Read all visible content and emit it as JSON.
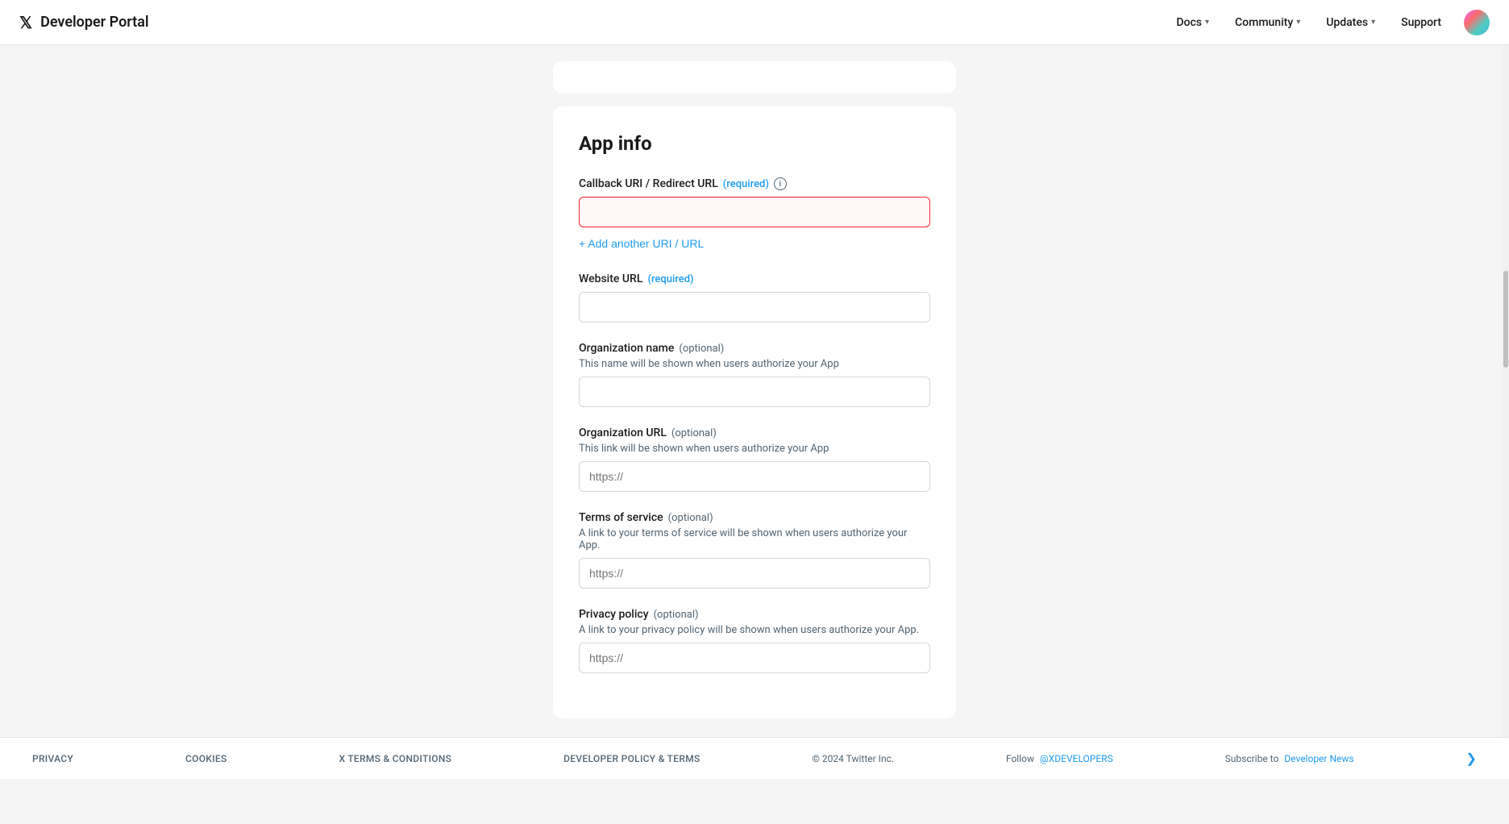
{
  "header": {
    "logo_text": "𝕏",
    "title": "Developer Portal",
    "nav": {
      "docs_label": "Docs",
      "community_label": "Community",
      "updates_label": "Updates",
      "support_label": "Support"
    }
  },
  "app_info": {
    "title": "App info",
    "callback_uri": {
      "label": "Callback URI / Redirect URL",
      "required_label": "(required)",
      "placeholder": "",
      "tooltip": "i"
    },
    "add_uri_btn": "+ Add another URI / URL",
    "website_url": {
      "label": "Website URL",
      "required_label": "(required)",
      "placeholder": ""
    },
    "org_name": {
      "label": "Organization name",
      "optional_label": "(optional)",
      "description": "This name will be shown when users authorize your App",
      "placeholder": ""
    },
    "org_url": {
      "label": "Organization URL",
      "optional_label": "(optional)",
      "description": "This link will be shown when users authorize your App",
      "placeholder": "https://"
    },
    "tos": {
      "label": "Terms of service",
      "optional_label": "(optional)",
      "description": "A link to your terms of service will be shown when users authorize your App.",
      "placeholder": "https://"
    },
    "privacy_policy": {
      "label": "Privacy policy",
      "optional_label": "(optional)",
      "description": "A link to your privacy policy will be shown when users authorize your App.",
      "placeholder": "https://"
    }
  },
  "footer": {
    "privacy": "Privacy",
    "cookies": "Cookies",
    "x_terms": "X Terms & Conditions",
    "dev_policy": "Developer Policy & Terms",
    "copyright": "© 2024 Twitter Inc.",
    "follow_label": "Follow",
    "follow_handle": "@XDEVELOPERS",
    "subscribe_label": "Subscribe to",
    "subscribe_link": "Developer News"
  }
}
